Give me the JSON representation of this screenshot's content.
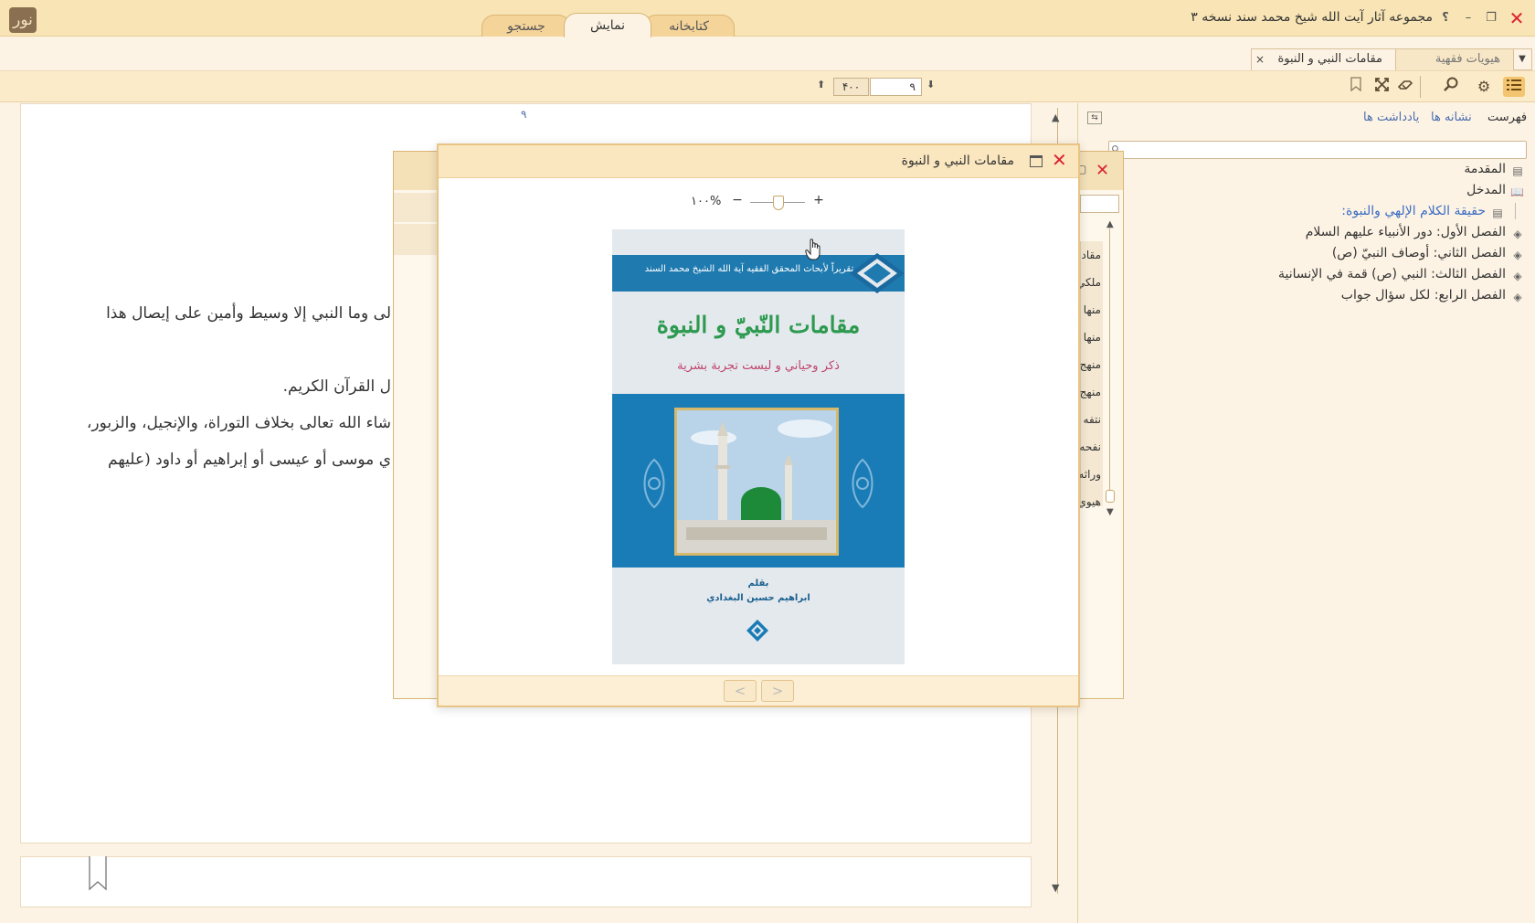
{
  "app": {
    "title": "مجموعه آثار آیت الله شیخ محمد سند نسخه ۳",
    "logo_text": "نور",
    "window_controls": {
      "close": "✕",
      "restore": "❐",
      "minimize": "–",
      "help": "؟"
    },
    "main_tabs": [
      "جستجو",
      "نمایش",
      "کتابخانه"
    ],
    "active_main_tab": "نمایش"
  },
  "document_tabs": {
    "tabs": [
      "هیویات فقهیة",
      "مقامات النبي و النبوة"
    ],
    "active": "مقامات النبي و النبوة",
    "close_glyph": "×",
    "dropdown_glyph": "▼"
  },
  "toolbar": {
    "icons": [
      "menu-icon",
      "gear-icon",
      "search-icon",
      "eraser-icon",
      "expand-icon",
      "bookmark-icon"
    ],
    "page_current": "۹",
    "page_total": "۴۰۰",
    "arrow_down": "⬇",
    "arrow_up": "⬆"
  },
  "reader": {
    "page_number": "۹",
    "lines": [
      "لى وما النبي إلا وسيط وأمين على إيصال هذا",
      "ل القرآن الكريم.",
      "شاء الله تعالى بخلاف التوراة، والإنجيل، والزبور،",
      "ي موسى أو عيسى أو إبراهيم أو داود (عليهم"
    ],
    "scroll_up": "▲",
    "scroll_down": "▼"
  },
  "right_panel": {
    "tabs": {
      "index": "فهرست",
      "bookmarks": "نشانه ها",
      "notes": "یادداشت ها"
    },
    "search_placeholder": "",
    "toc": [
      {
        "label": "المقدمة",
        "icon": "page-icon"
      },
      {
        "label": "المدخل",
        "icon": "book-open-icon"
      },
      {
        "label": "حقيقة الكلام الإلهي والنبوة:",
        "icon": "page-icon",
        "selected": true
      },
      {
        "label": "الفصل الأول: دور الأنبياء عليهم السلام",
        "icon": "book-icon"
      },
      {
        "label": "الفصل الثاني: أوصاف النبيّ (ص)",
        "icon": "book-icon"
      },
      {
        "label": "الفصل الثالث: النبي (ص) قمة في الإنسانية",
        "icon": "book-icon"
      },
      {
        "label": "الفصل الرابع: لكل سؤال جواب",
        "icon": "book-icon"
      }
    ]
  },
  "background_dialog": {
    "list": [
      "مقاد",
      "ملكي",
      "منها",
      "منها",
      "منهج",
      "منهج",
      "نتفه",
      "نفحه",
      "وراثه",
      "هيوي"
    ]
  },
  "dialog": {
    "title": "مقامات النبي و النبوة",
    "zoom_label": "۱۰۰%",
    "zoom_minus": "−",
    "zoom_plus": "+",
    "prev": "<",
    "next": ">",
    "cover": {
      "band_text": "تقريراً لأبحاث المحقق الفقيه آية الله الشيخ محمد السند",
      "title": "مقامات النّبيّ و النبوة",
      "subtitle": "ذكر وحياني و ليست تجربة بشرية",
      "author_label": "بقلم",
      "author": "ابراهيم حسين البغدادي"
    }
  },
  "colors": {
    "accent": "#f4c570",
    "cover_blue": "#1a7cb6",
    "cover_green": "#2d9a4f",
    "close_red": "#dd2233",
    "link_blue": "#4a6fb0"
  }
}
